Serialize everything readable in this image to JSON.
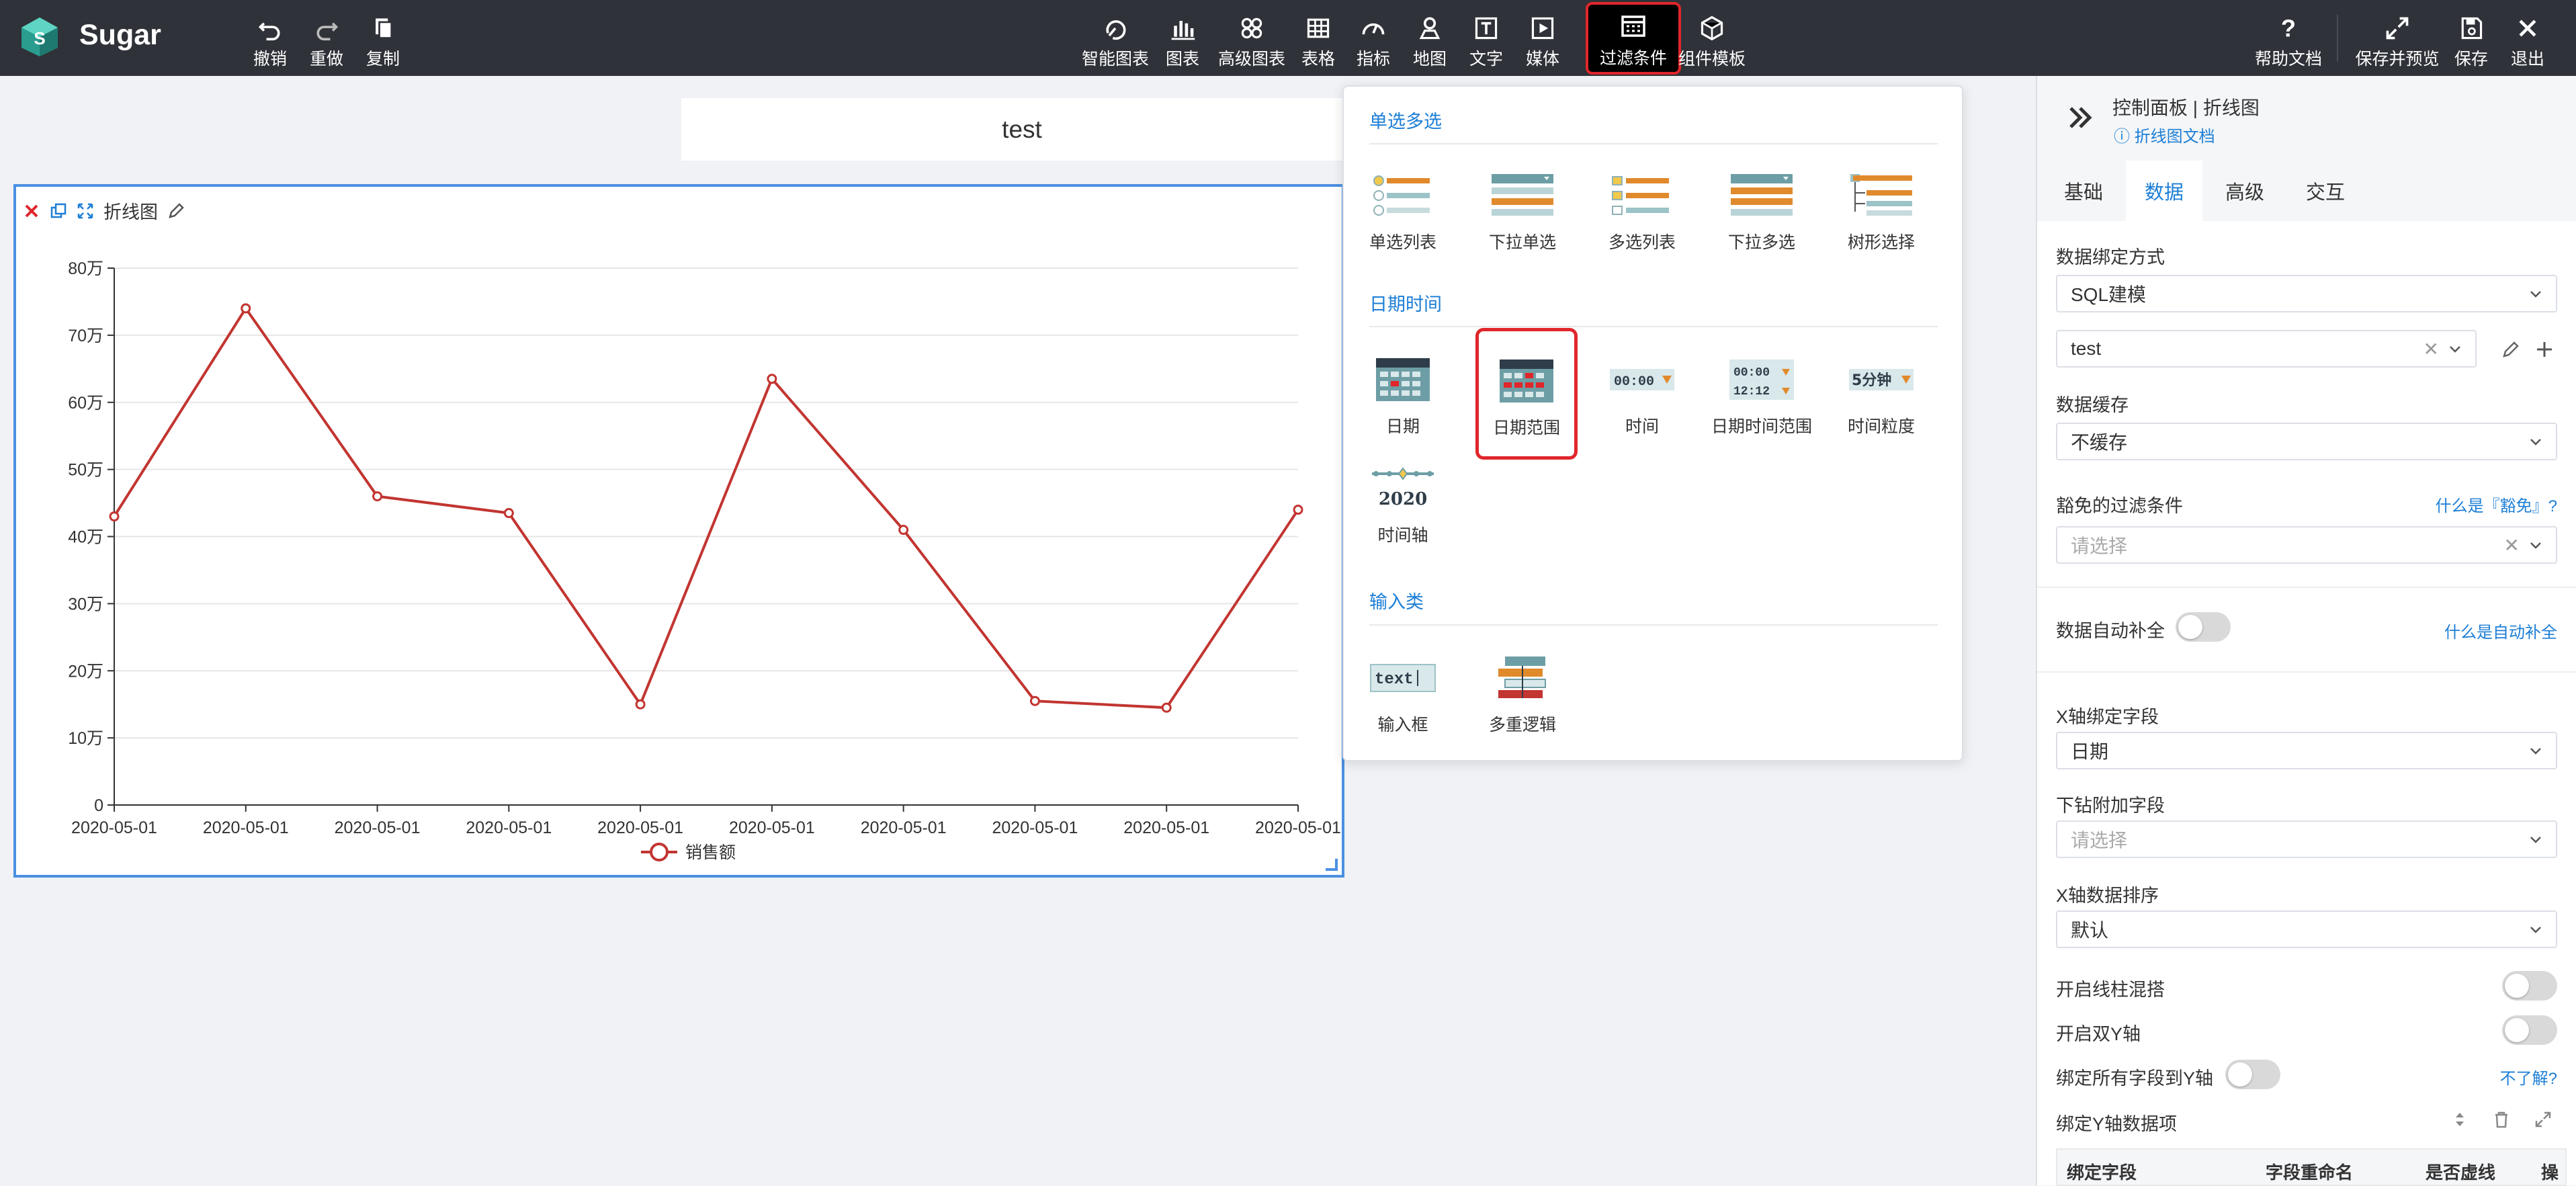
{
  "app": {
    "name": "Sugar",
    "accent": "#1c7ed6",
    "topbar_bg": "#2f3238"
  },
  "toolbar": {
    "undo": "撤销",
    "redo": "重做",
    "copy": "复制",
    "smart_chart": "智能图表",
    "chart": "图表",
    "advanced_chart": "高级图表",
    "table": "表格",
    "metric": "指标",
    "map": "地图",
    "text": "文字",
    "media": "媒体",
    "filter": "过滤条件",
    "component_template": "组件模板",
    "help": "帮助文档",
    "save_preview": "保存并预览",
    "save": "保存",
    "exit": "退出"
  },
  "canvas": {
    "title": "test",
    "chart_title": "折线图"
  },
  "chart_data": {
    "type": "line",
    "categories": [
      "2020-05-01",
      "2020-05-01",
      "2020-05-01",
      "2020-05-01",
      "2020-05-01",
      "2020-05-01",
      "2020-05-01",
      "2020-05-01",
      "2020-05-01",
      "2020-05-01"
    ],
    "series": [
      {
        "name": "销售额",
        "color": "#c23531",
        "values": [
          43,
          74,
          46,
          43.5,
          15,
          63.5,
          41,
          15.5,
          14.5,
          44
        ]
      }
    ],
    "yticks": [
      "0",
      "10万",
      "20万",
      "30万",
      "40万",
      "50万",
      "60万",
      "70万",
      "80万"
    ],
    "ylim": [
      0,
      80
    ],
    "grid": true,
    "legend": "bottom-center"
  },
  "filter_panel": {
    "single_multi": {
      "title": "单选多选",
      "options": [
        "单选列表",
        "下拉单选",
        "多选列表",
        "下拉多选",
        "树形选择"
      ]
    },
    "datetime": {
      "title": "日期时间",
      "options": [
        "日期",
        "日期范围",
        "时间",
        "日期时间范围",
        "时间粒度",
        "时间轴"
      ],
      "selected": "日期范围",
      "time_icon_text": "00:00",
      "datetime_icon_top": "00:00",
      "datetime_icon_bottom": "12:12",
      "granularity_icon_text": "5分钟",
      "timeline_icon_text": "2020"
    },
    "input": {
      "title": "输入类",
      "options": [
        "输入框",
        "多重逻辑"
      ],
      "input_icon_text": "text"
    }
  },
  "control_panel": {
    "title": "控制面板 | 折线图",
    "doc_link": "折线图文档",
    "tabs": [
      "基础",
      "数据",
      "高级",
      "交互"
    ],
    "active_tab": "数据",
    "binding_label": "数据绑定方式",
    "binding_value": "SQL建模",
    "model_value": "test",
    "cache_label": "数据缓存",
    "cache_value": "不缓存",
    "exempt_label": "豁免的过滤条件",
    "exempt_link": "什么是『豁免』?",
    "exempt_placeholder": "请选择",
    "autofill_label": "数据自动补全",
    "autofill_link": "什么是自动补全",
    "x_field_label": "X轴绑定字段",
    "x_field_value": "日期",
    "drill_label": "下钻附加字段",
    "drill_placeholder": "请选择",
    "x_sort_label": "X轴数据排序",
    "x_sort_value": "默认",
    "mix_label": "开启线柱混搭",
    "dual_y_label": "开启双Y轴",
    "bind_all_label": "绑定所有字段到Y轴",
    "bind_all_link": "不了解?",
    "y_items_label": "绑定Y轴数据项",
    "table_headers": [
      "绑定字段",
      "字段重命名",
      "是否虚线",
      "操"
    ]
  }
}
